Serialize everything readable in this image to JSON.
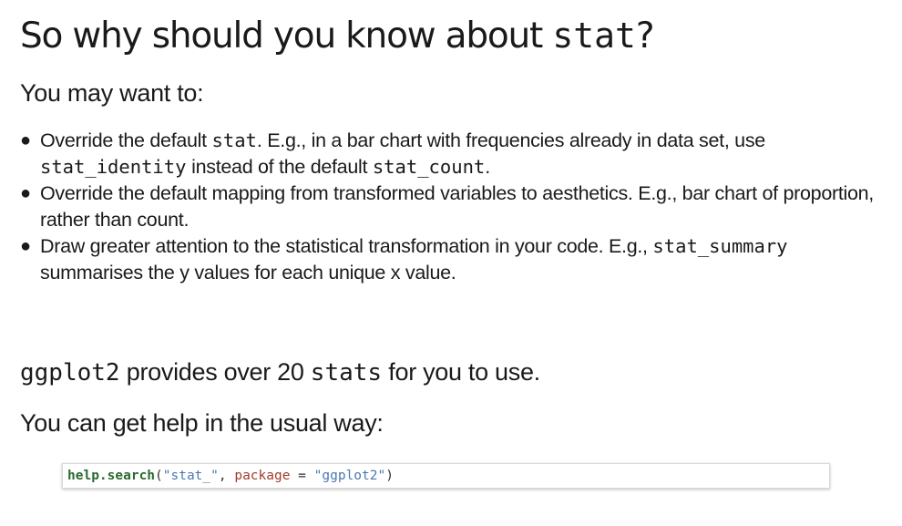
{
  "title": {
    "text": "So why should you know about ",
    "code": "stat",
    "suffix": "?"
  },
  "intro": "You may want to:",
  "bullets": [
    {
      "parts": [
        {
          "t": "Override the default "
        },
        {
          "c": "stat"
        },
        {
          "t": ". E.g., in a bar chart with frequencies already in data set, use "
        },
        {
          "c": "stat_identity"
        },
        {
          "t": " instead of the default "
        },
        {
          "c": "stat_count"
        },
        {
          "t": "."
        }
      ]
    },
    {
      "parts": [
        {
          "t": "Override the default mapping from transformed variables to aesthetics. E.g., bar chart of proportion, rather than count."
        }
      ]
    },
    {
      "parts": [
        {
          "t": "Draw greater attention to the statistical transformation in your code. E.g., "
        },
        {
          "c": "stat_summary"
        },
        {
          "t": " summarises the y values for each unique x value."
        }
      ]
    }
  ],
  "provides": {
    "code1": "ggplot2",
    "text1": " provides over 20 ",
    "code2": "stats",
    "text2": " for you to use."
  },
  "help_line": "You can get help in the usual way:",
  "code_block": {
    "fn": "help.search",
    "open": "(",
    "arg1": "\"stat_\"",
    "comma": ", ",
    "param": "package",
    "eq": " = ",
    "arg2": "\"ggplot2\"",
    "close": ")"
  },
  "colors": {
    "function": "#2b6a2e",
    "string": "#4a79b0",
    "argument": "#a33b2a"
  }
}
